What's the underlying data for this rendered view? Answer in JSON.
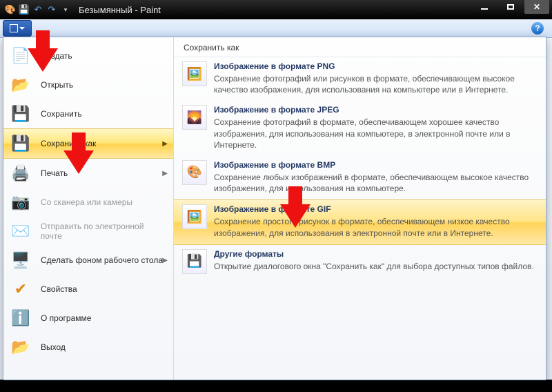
{
  "titlebar": {
    "title": "Безымянный - Paint"
  },
  "menu": {
    "create": "Создать",
    "open": "Открыть",
    "save": "Сохранить",
    "saveas": "Сохранить как",
    "print": "Печать",
    "scan": "Со сканера или камеры",
    "mail": "Отправить по электронной почте",
    "desk": "Сделать фоном рабочего стола",
    "props": "Свойства",
    "about": "О программе",
    "exit": "Выход"
  },
  "right": {
    "header": "Сохранить как",
    "png": {
      "title": "Изображение в формате PNG",
      "desc": "Сохранение фотографий или рисунков в формате, обеспечивающем высокое качество изображения, для использования на компьютере или в Интернете."
    },
    "jpeg": {
      "title": "Изображение в формате JPEG",
      "desc": "Сохранение фотографий в формате, обеспечивающем хорошее качество изображения, для использования на компьютере, в электронной почте или в Интернете."
    },
    "bmp": {
      "title": "Изображение в формате BMP",
      "desc": "Сохранение любых изображений в формате, обеспечивающем высокое качество изображения, для использования на компьютере."
    },
    "gif": {
      "title": "Изображение в формате GIF",
      "desc": "Сохранение простого рисунок в формате, обеспечивающем низкое качество изображения, для использования в электронной почте или в Интернете."
    },
    "other": {
      "title": "Другие форматы",
      "desc": "Открытие диалогового окна \"Сохранить как\" для выбора доступных типов файлов."
    }
  }
}
